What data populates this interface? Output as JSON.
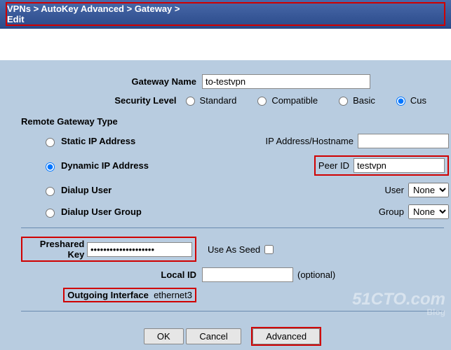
{
  "breadcrumb": "VPNs > AutoKey Advanced > Gateway > Edit",
  "form": {
    "gateway_name_label": "Gateway Name",
    "gateway_name_value": "to-testvpn",
    "security_level_label": "Security Level",
    "sec_standard": "Standard",
    "sec_compatible": "Compatible",
    "sec_basic": "Basic",
    "sec_custom": "Cus",
    "remote_section": "Remote Gateway Type",
    "opt_static": "Static IP Address",
    "opt_static_right": "IP Address/Hostname",
    "opt_dynamic": "Dynamic IP Address",
    "peer_id_label": "Peer ID",
    "peer_id_value": "testvpn",
    "opt_dialup_user": "Dialup User",
    "user_label": "User",
    "user_value": "None",
    "opt_dialup_group": "Dialup User Group",
    "group_label": "Group",
    "group_value": "None",
    "preshared_label": "Preshared Key",
    "preshared_value": "••••••••••••••••••••",
    "use_as_seed": "Use As Seed",
    "local_id_label": "Local ID",
    "local_id_value": "",
    "local_id_hint": "(optional)",
    "outgoing_if_label": "Outgoing Interface",
    "outgoing_if_value": "ethernet3"
  },
  "buttons": {
    "ok": "OK",
    "cancel": "Cancel",
    "advanced": "Advanced"
  },
  "watermark": {
    "main": "51CTO.com",
    "sub": "Blog"
  },
  "colors": {
    "bg": "#b8cce0",
    "highlight": "#d00000",
    "header": "#2a4a8a"
  }
}
